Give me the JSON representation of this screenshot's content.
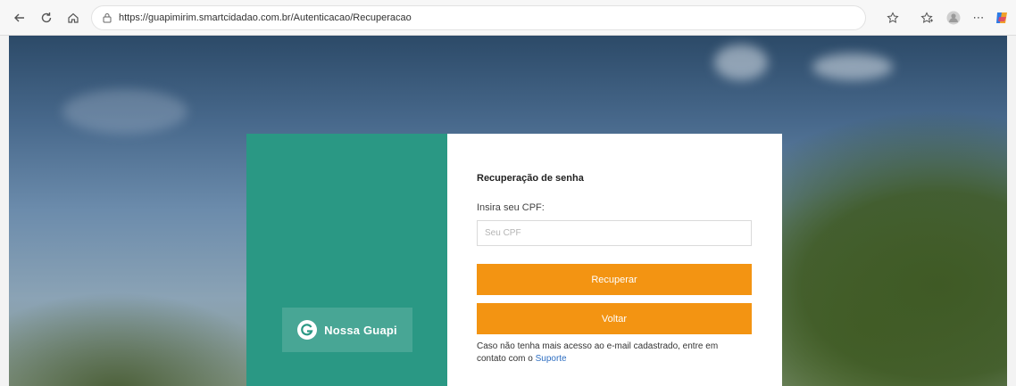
{
  "browser": {
    "url": "https://guapimirim.smartcidadao.com.br/Autenticacao/Recuperacao",
    "icons": [
      "back-icon",
      "refresh-icon",
      "home-icon",
      "lock-icon",
      "favorite-icon",
      "collections-icon",
      "profile-icon",
      "more-icon",
      "copilot-icon"
    ]
  },
  "brand": {
    "logo_text": "Nossa Guapi",
    "colors": {
      "panel": "#2a9884",
      "button": "#f39412",
      "link": "#2f6fc2"
    }
  },
  "form": {
    "title": "Recuperação de senha",
    "cpf_label": "Insira seu CPF:",
    "cpf_placeholder": "Seu CPF",
    "cpf_value": "",
    "submit_label": "Recuperar",
    "back_label": "Voltar",
    "help_text": "Caso não tenha mais acesso ao e-mail cadastrado, entre em contato com o ",
    "help_link": "Suporte"
  }
}
